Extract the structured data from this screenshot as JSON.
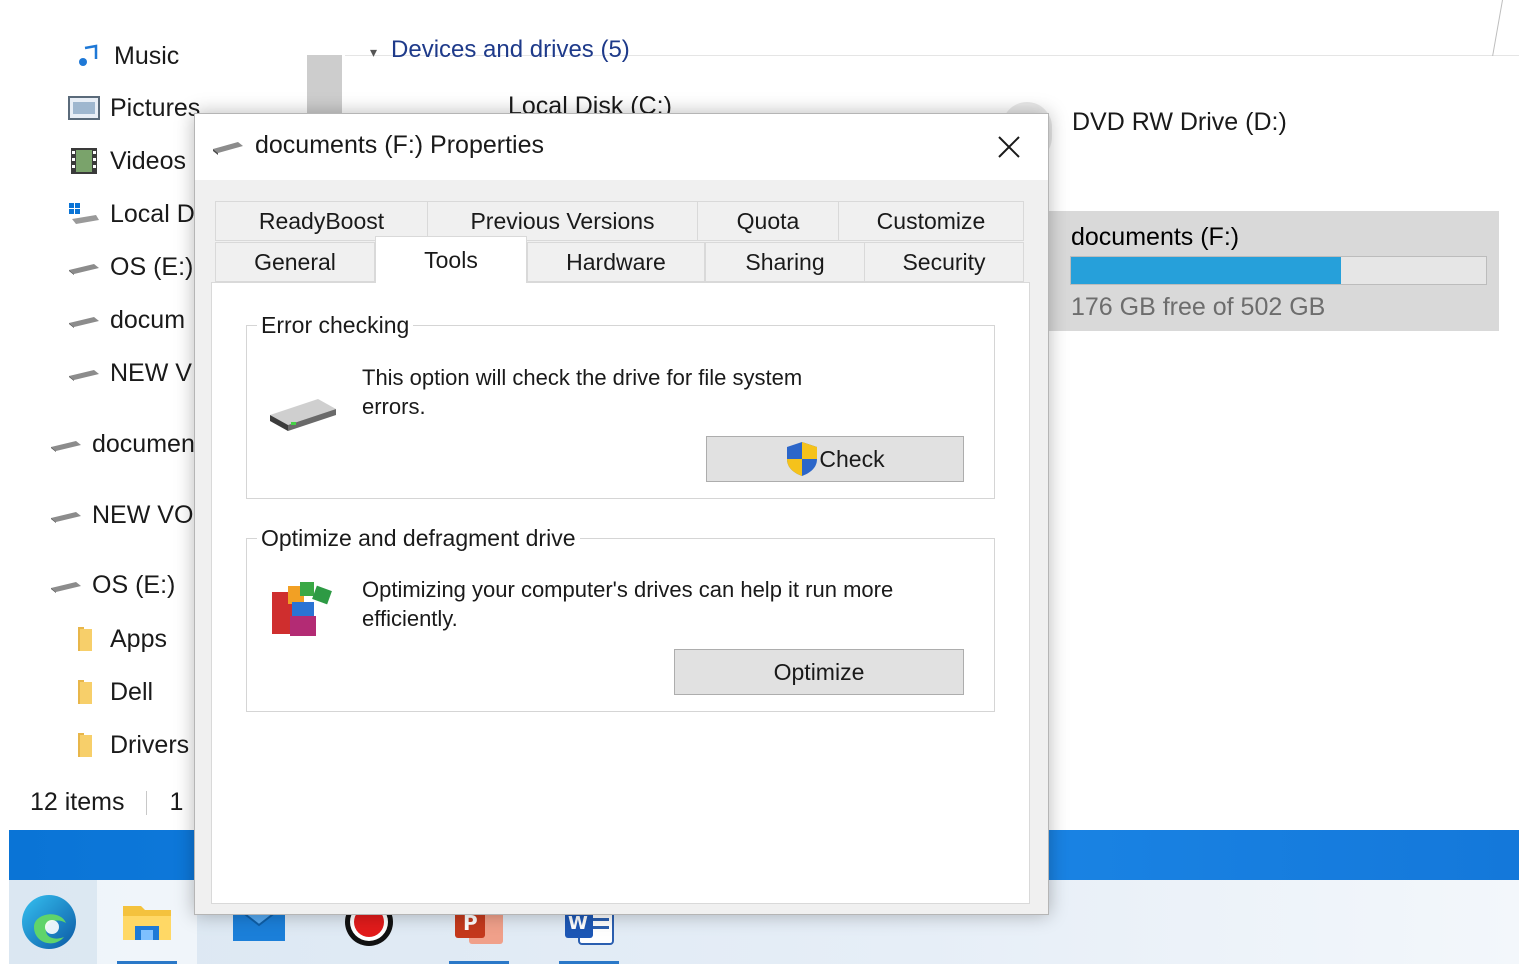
{
  "explorer": {
    "nav_items": [
      {
        "label": "Music",
        "icon": "music-icon"
      },
      {
        "label": "Pictures",
        "icon": "pictures-icon"
      },
      {
        "label": "Videos",
        "icon": "videos-icon"
      },
      {
        "label": "Local D",
        "icon": "local-disk-icon"
      },
      {
        "label": "OS (E:)",
        "icon": "drive-icon"
      },
      {
        "label": "docum",
        "icon": "drive-icon"
      },
      {
        "label": "NEW V",
        "icon": "drive-icon"
      },
      {
        "label": "documen",
        "icon": "drive-icon"
      },
      {
        "label": "NEW VO",
        "icon": "drive-icon"
      },
      {
        "label": "OS (E:)",
        "icon": "drive-icon"
      },
      {
        "label": "Apps",
        "icon": "folder-icon"
      },
      {
        "label": "Dell",
        "icon": "folder-icon"
      },
      {
        "label": "Drivers",
        "icon": "folder-icon"
      }
    ],
    "section_header": "Devices and drives (5)",
    "drives": {
      "local_c": "Local Disk (C:)",
      "dvd_d": "DVD RW Drive (D:)",
      "selected": {
        "name": "documents (F:)",
        "free_text": "176 GB free of 502 GB",
        "used_fraction": 0.65
      }
    },
    "status": {
      "items": "12 items",
      "extra": "1"
    }
  },
  "dialog": {
    "title": "documents (F:) Properties",
    "tabs_row1": [
      "ReadyBoost",
      "Previous Versions",
      "Quota",
      "Customize"
    ],
    "tabs_row2": [
      "General",
      "Tools",
      "Hardware",
      "Sharing",
      "Security"
    ],
    "active_tab": "Tools",
    "error_checking": {
      "legend": "Error checking",
      "line1": "This option will check the drive for file system",
      "line2": "errors.",
      "button": "Check"
    },
    "optimize": {
      "legend": "Optimize and defragment drive",
      "line1": "Optimizing your computer's drives can help it run more",
      "line2": "efficiently.",
      "button": "Optimize"
    }
  },
  "taskbar": {
    "apps": [
      "edge-icon",
      "file-explorer-icon",
      "mail-icon",
      "record-icon",
      "powerpoint-icon",
      "word-icon"
    ]
  },
  "colors": {
    "accent": "#26a0da",
    "selection": "#d9d9d9",
    "taskbar_blue": "#0a74d6"
  }
}
